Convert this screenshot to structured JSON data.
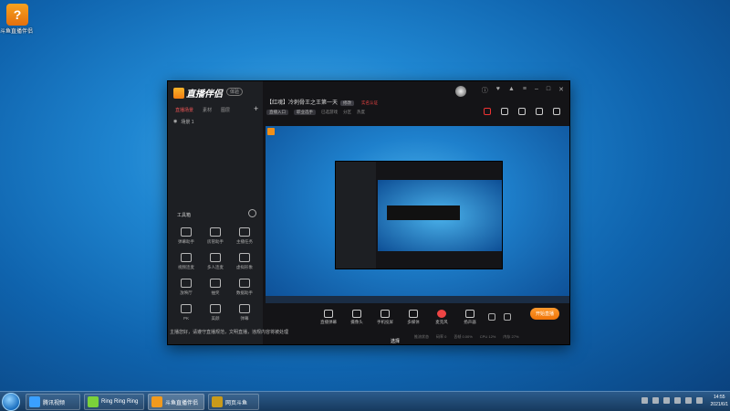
{
  "desktop": {
    "icon_label": "斗鱼直播伴侣"
  },
  "app": {
    "logo_text": "直播伴侣",
    "version_badge": "体验",
    "sidebar_tabs": [
      "直播场景",
      "素材",
      "图层"
    ],
    "scene_label": "场景 1",
    "toolbox_title": "工具箱",
    "tools": [
      "弹幕助手",
      "房管助手",
      "主播任务",
      "视频连麦",
      "多人连麦",
      "虚拟形象",
      "放映厅",
      "抽奖",
      "数据助手",
      "PK",
      "美颜",
      "弹幕"
    ],
    "notice": "主播您好，请遵守直播规范，文明直播，违规内容将被处理",
    "title": "【红魂】冷刺骨王之王第一天",
    "title_badge": "修改",
    "title_red": "实名认证",
    "sub_tag1": "直播入口",
    "sub_tag2": "职业选手",
    "sub_item1": "已选游戏",
    "sub_item2": "分区",
    "sub_item3": "热度",
    "toolbar": [
      "直播弹幕",
      "摄像头",
      "手机投屏",
      "多媒体",
      "麦克风",
      "扬声器"
    ],
    "live_button": "开始直播",
    "status": [
      "推流状态",
      "码率 0",
      "丢帧 0.00%",
      "CPU 12%",
      "内存 27%"
    ]
  },
  "taskbar": {
    "items": [
      "腾讯视频",
      "Ring Ring Ring",
      "斗鱼直播伴侣",
      "网页斗鱼"
    ],
    "time": "14:55",
    "date": "2021/6/1"
  },
  "cursor_label": "选择"
}
